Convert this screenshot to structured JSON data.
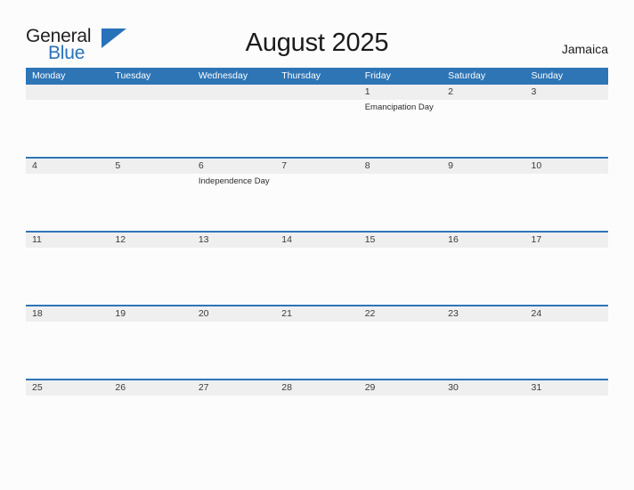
{
  "brand": {
    "name_part1": "General",
    "name_part2": "Blue",
    "flag_icon": "blue-triangle-flag-icon",
    "color_dark": "#231f20",
    "color_blue": "#2872b9"
  },
  "header": {
    "title": "August 2025",
    "region": "Jamaica"
  },
  "colors": {
    "header_bar": "#2e75b6",
    "date_band": "#efefef",
    "separator": "#2e75b6",
    "page_background": "#fcfcfd",
    "text": "#1b1b1b"
  },
  "weekdays": [
    "Monday",
    "Tuesday",
    "Wednesday",
    "Thursday",
    "Friday",
    "Saturday",
    "Sunday"
  ],
  "weeks": [
    {
      "days": [
        {
          "date": "",
          "events": []
        },
        {
          "date": "",
          "events": []
        },
        {
          "date": "",
          "events": []
        },
        {
          "date": "",
          "events": []
        },
        {
          "date": "1",
          "events": [
            "Emancipation Day"
          ]
        },
        {
          "date": "2",
          "events": []
        },
        {
          "date": "3",
          "events": []
        }
      ]
    },
    {
      "days": [
        {
          "date": "4",
          "events": []
        },
        {
          "date": "5",
          "events": []
        },
        {
          "date": "6",
          "events": [
            "Independence Day"
          ]
        },
        {
          "date": "7",
          "events": []
        },
        {
          "date": "8",
          "events": []
        },
        {
          "date": "9",
          "events": []
        },
        {
          "date": "10",
          "events": []
        }
      ]
    },
    {
      "days": [
        {
          "date": "11",
          "events": []
        },
        {
          "date": "12",
          "events": []
        },
        {
          "date": "13",
          "events": []
        },
        {
          "date": "14",
          "events": []
        },
        {
          "date": "15",
          "events": []
        },
        {
          "date": "16",
          "events": []
        },
        {
          "date": "17",
          "events": []
        }
      ]
    },
    {
      "days": [
        {
          "date": "18",
          "events": []
        },
        {
          "date": "19",
          "events": []
        },
        {
          "date": "20",
          "events": []
        },
        {
          "date": "21",
          "events": []
        },
        {
          "date": "22",
          "events": []
        },
        {
          "date": "23",
          "events": []
        },
        {
          "date": "24",
          "events": []
        }
      ]
    },
    {
      "days": [
        {
          "date": "25",
          "events": []
        },
        {
          "date": "26",
          "events": []
        },
        {
          "date": "27",
          "events": []
        },
        {
          "date": "28",
          "events": []
        },
        {
          "date": "29",
          "events": []
        },
        {
          "date": "30",
          "events": []
        },
        {
          "date": "31",
          "events": []
        }
      ]
    }
  ]
}
